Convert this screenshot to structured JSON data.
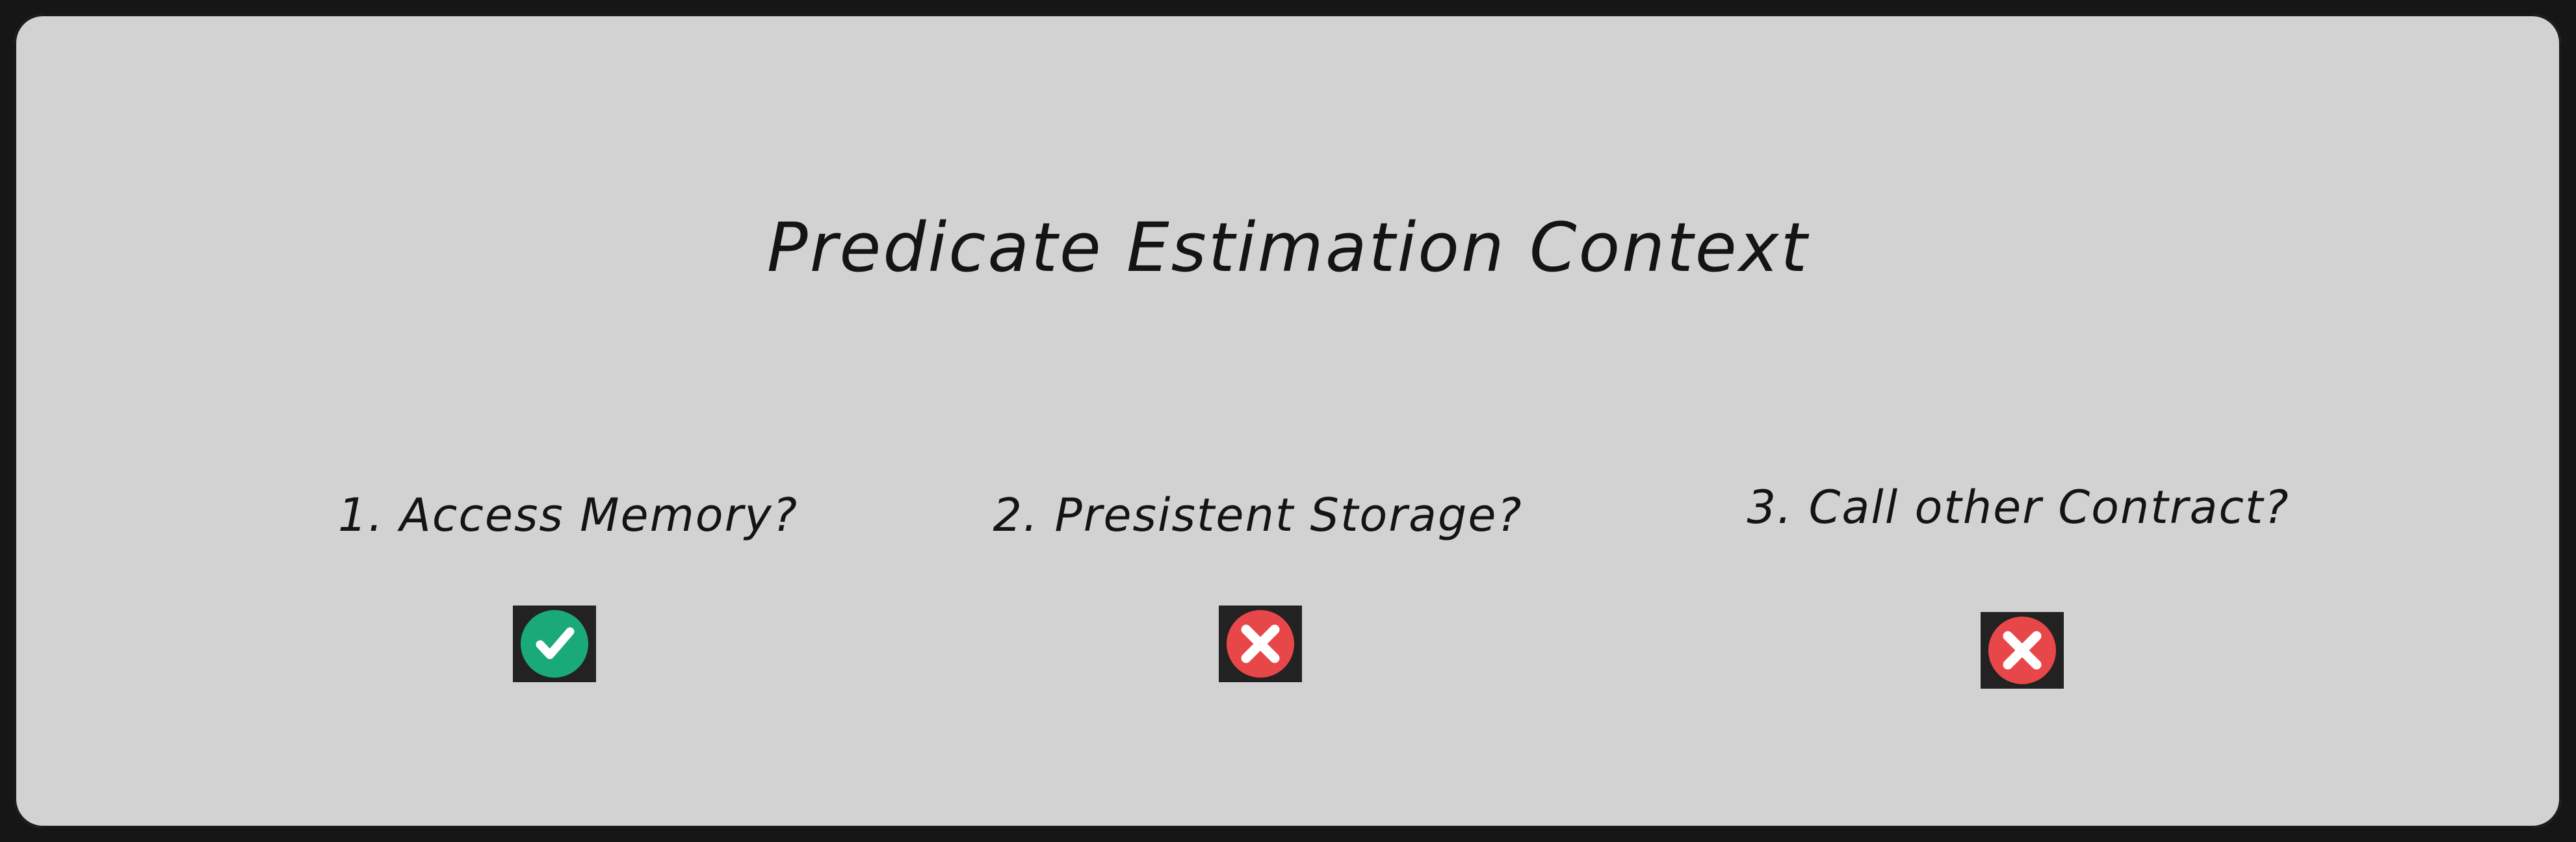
{
  "title": "Predicate Estimation Context",
  "items": [
    {
      "label": "1. Access Memory?",
      "status": "allowed",
      "icon": "check-circle-icon",
      "color": "#1aaa7a"
    },
    {
      "label": "2. Presistent Storage?",
      "status": "denied",
      "icon": "x-circle-icon",
      "color": "#e8474a"
    },
    {
      "label": "3. Call other Contract?",
      "status": "denied",
      "icon": "x-circle-icon",
      "color": "#e8474a"
    }
  ],
  "colors": {
    "background": "#d2d2d2",
    "frame": "#161616",
    "text": "#141414",
    "icon_box": "#222222"
  }
}
